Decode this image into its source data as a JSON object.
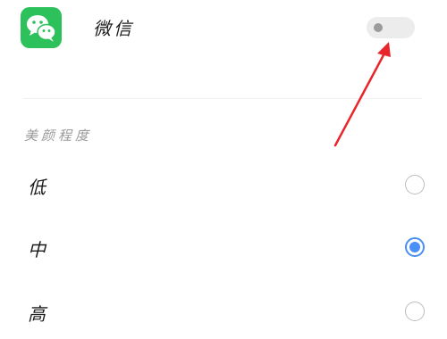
{
  "app": {
    "name": "微信",
    "icon": "wechat-icon",
    "notification_toggle": {
      "state": "off"
    }
  },
  "beauty_section": {
    "title": "美颜程度",
    "options": [
      {
        "label": "低",
        "selected": false
      },
      {
        "label": "中",
        "selected": true
      },
      {
        "label": "高",
        "selected": false
      }
    ]
  },
  "colors": {
    "app_icon_green": "#2dc15b",
    "radio_selected": "#4a8ff5",
    "annotation_arrow": "#e8252b"
  }
}
